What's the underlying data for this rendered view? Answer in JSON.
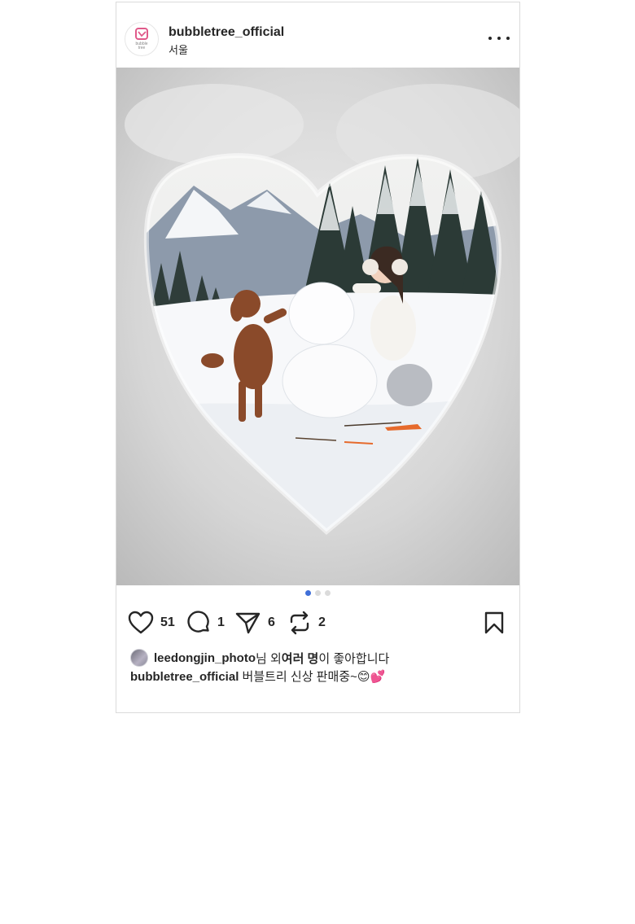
{
  "post": {
    "username": "bubbletree_official",
    "location": "서울",
    "avatar_logo_text": "bubble tree",
    "slide_count": 3,
    "active_slide": 1,
    "image_icon": "snowman-heart-photo",
    "actions": {
      "like_icon": "heart-icon",
      "like_count": "51",
      "comment_icon": "comment-icon",
      "comment_count": "1",
      "share_icon": "send-icon",
      "share_count": "6",
      "repost_icon": "repost-icon",
      "repost_count": "2",
      "save_icon": "bookmark-icon"
    },
    "likes": {
      "liker": "leedongjin_photo",
      "suffix_1": "님 외 ",
      "others": "여러 명",
      "suffix_2": "이 좋아합니다"
    },
    "caption": {
      "author": "bubbletree_official",
      "text": " 버블트리 신상 판매중~",
      "emojis": "😊💕"
    }
  },
  "colors": {
    "active_dot": "#3f6fd8",
    "inactive_dot": "#dbdbdb",
    "border": "#dbdbdb",
    "text": "#262626",
    "brand_pink": "#e05a8a"
  }
}
